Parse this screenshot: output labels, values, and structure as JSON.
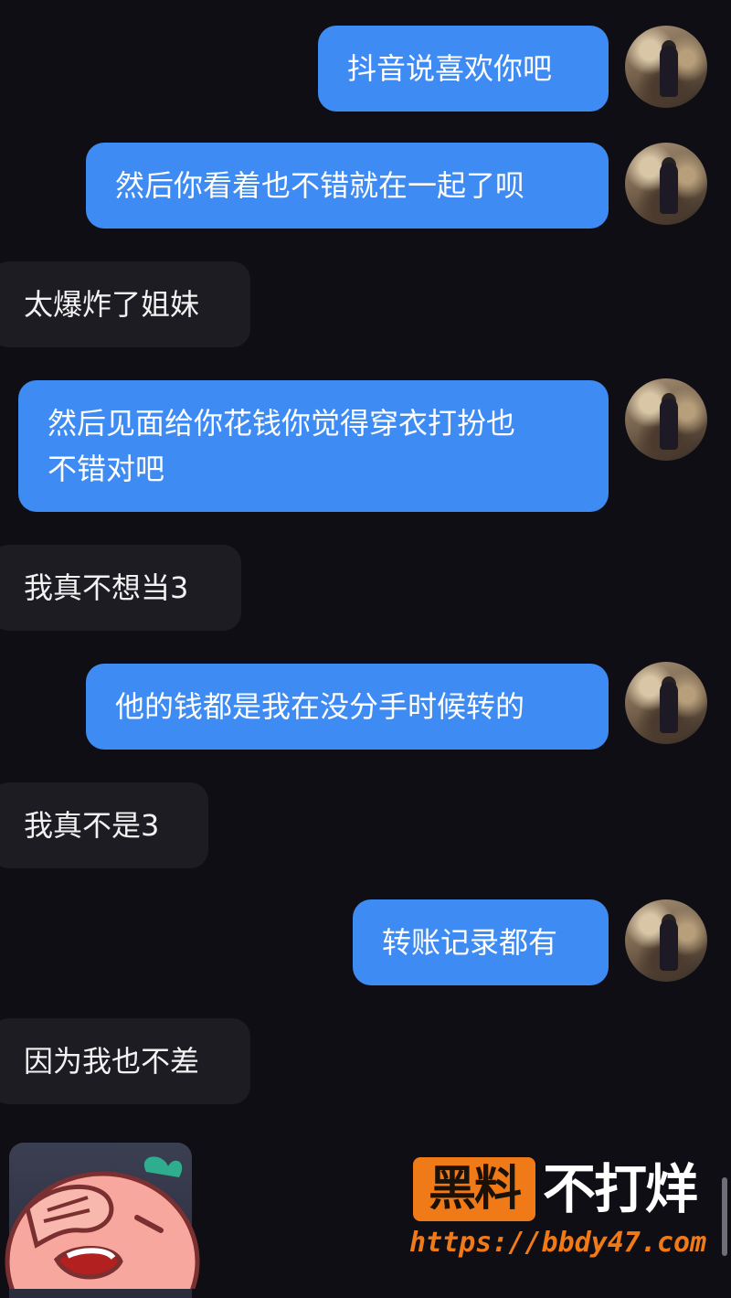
{
  "messages": [
    {
      "side": "me",
      "text": "抖音说喜欢你吧"
    },
    {
      "side": "me",
      "text": "然后你看着也不错就在一起了呗"
    },
    {
      "side": "them",
      "text": "太爆炸了姐妹"
    },
    {
      "side": "me",
      "text_line1": "然后见面给你花钱你觉得穿衣打扮也",
      "text_line2": "不错对吧"
    },
    {
      "side": "them",
      "text": "我真不想当3"
    },
    {
      "side": "me",
      "text": "他的钱都是我在没分手时候转的"
    },
    {
      "side": "them",
      "text": "我真不是3"
    },
    {
      "side": "me",
      "text": "转账记录都有"
    },
    {
      "side": "them",
      "text": "因为我也不差"
    }
  ],
  "sticker": {
    "icon": "facepalm-crying-sticker-icon"
  },
  "watermark": {
    "box_text": "黑料",
    "rest_text": "不打烊",
    "url": "https://bbdy47.com"
  },
  "colors": {
    "background": "#0f0e15",
    "my_bubble": "#3e8bf4",
    "their_bubble": "#1d1c23",
    "watermark_orange": "#f07a17"
  }
}
